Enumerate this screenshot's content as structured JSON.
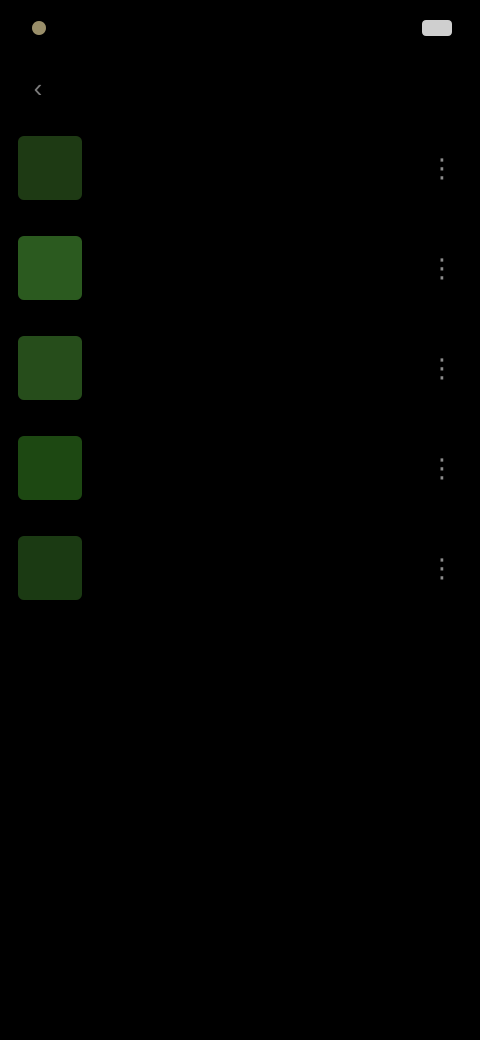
{
  "status_bar": {
    "time": "",
    "icons": ""
  },
  "toolbar": {
    "title": ""
  },
  "list": {
    "items": [
      {
        "title": "",
        "subtitle": "",
        "thumb_color": "#1e3a14"
      },
      {
        "title": "",
        "subtitle": "",
        "thumb_color": "#2b5a1f"
      },
      {
        "title": "",
        "subtitle": "",
        "thumb_color": "#264d1b"
      },
      {
        "title": "",
        "subtitle": "",
        "thumb_color": "#1d4812"
      },
      {
        "title": "",
        "subtitle": "",
        "thumb_color": "#1b3a13"
      }
    ]
  },
  "colors": {
    "background": "#000000",
    "thumb_accent": "#2b5a1f"
  }
}
